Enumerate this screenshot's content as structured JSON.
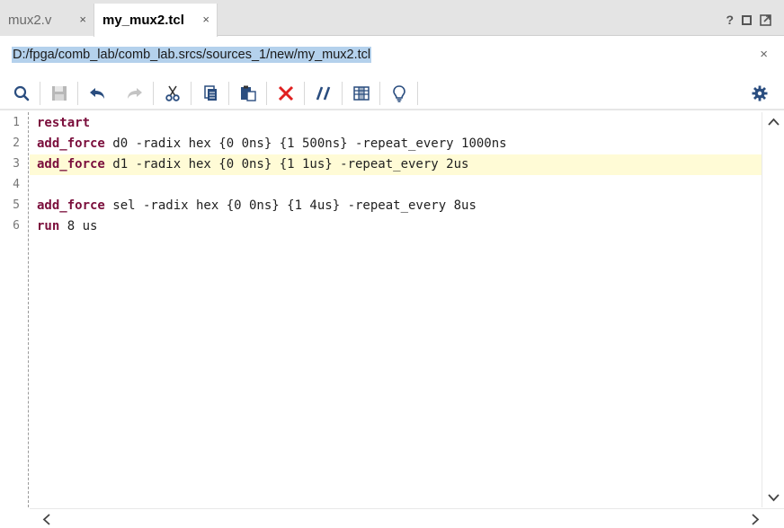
{
  "tabs": [
    {
      "label": "mux2.v",
      "active": false,
      "close": "×"
    },
    {
      "label": "my_mux2.tcl",
      "active": true,
      "close": "×"
    }
  ],
  "window_buttons": {
    "help": "?"
  },
  "path": {
    "text": "D:/fpga/comb_lab/comb_lab.srcs/sources_1/new/my_mux2.tcl",
    "close": "×"
  },
  "toolbar_icons": [
    "search-icon",
    "save-icon",
    "undo-icon",
    "redo-icon",
    "cut-icon",
    "copy-icon",
    "paste-icon",
    "delete-icon",
    "comment-icon",
    "column-icon",
    "lightbulb-icon",
    "gear-icon"
  ],
  "editor": {
    "line_numbers": [
      "1",
      "2",
      "3",
      "4",
      "5",
      "6"
    ],
    "lines": [
      {
        "kw": "restart",
        "rest": ""
      },
      {
        "kw": "add_force",
        "rest": " d0 -radix hex {0 0ns} {1 500ns} -repeat_every 1000ns"
      },
      {
        "kw": "add_force",
        "rest": " d1 -radix hex {0 0ns} {1 1us} -repeat_every 2us"
      },
      {
        "kw": "",
        "rest": ""
      },
      {
        "kw": "add_force",
        "rest": " sel -radix hex {0 0ns} {1 4us} -repeat_every 8us"
      },
      {
        "kw": "run",
        "rest": " 8 us"
      }
    ],
    "highlighted_line": 3
  },
  "colors": {
    "keyword": "#7b0f3c",
    "highlight": "#fffbd6",
    "selection": "#b4d1ec",
    "icon_blue": "#2a4d7f",
    "delete_red": "#e02020"
  }
}
